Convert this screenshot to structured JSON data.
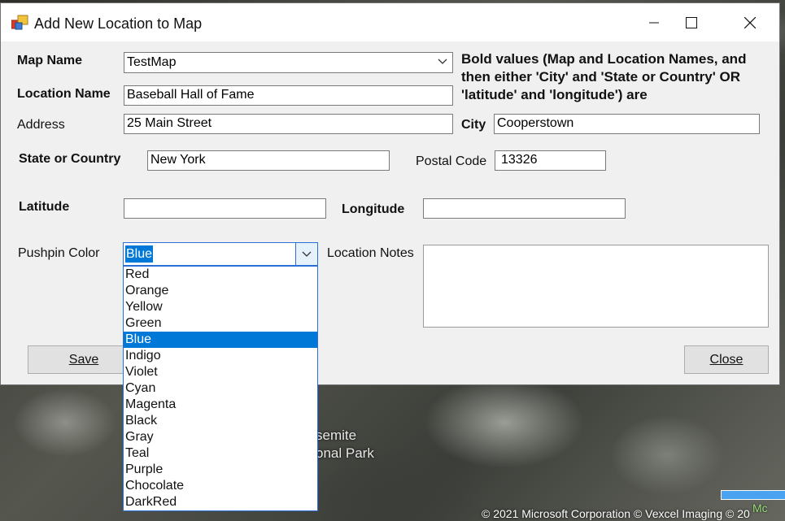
{
  "window": {
    "title": "Add New Location to Map",
    "minimize": "—",
    "maximize": "☐",
    "close": "✕"
  },
  "form": {
    "map_name_label": "Map Name",
    "map_name_value": "TestMap",
    "location_name_label": "Location Name",
    "location_name_value": "Baseball Hall of Fame",
    "address_label": "Address",
    "address_value": "25 Main Street",
    "city_label": "City",
    "city_value": "Cooperstown",
    "state_label": "State or Country",
    "state_value": "New York",
    "postal_label": "Postal Code",
    "postal_value": "13326",
    "latitude_label": "Latitude",
    "latitude_value": "",
    "longitude_label": "Longitude",
    "longitude_value": "",
    "pushpin_label": "Pushpin Color",
    "pushpin_value": "Blue",
    "notes_label": "Location Notes",
    "notes_value": "",
    "instructions": "Bold values (Map and Location Names, and then either 'City' and 'State or Country' OR 'latitude' and 'longitude') are"
  },
  "pushpin_options": [
    "Red",
    "Orange",
    "Yellow",
    "Green",
    "Blue",
    "Indigo",
    "Violet",
    "Cyan",
    "Magenta",
    "Black",
    "Gray",
    "Teal",
    "Purple",
    "Chocolate",
    "DarkRed"
  ],
  "selected_option": "Blue",
  "buttons": {
    "save": "Save",
    "close": "Close"
  },
  "map": {
    "park_label_line1": "semite",
    "park_label_line2": "onal Park",
    "copyright": "© 2021 Microsoft Corporation   © Vexcel Imaging   © 20",
    "badge": "Mc"
  },
  "colors": {
    "selection": "#0078d7",
    "focus_border": "#2a6fd6"
  }
}
